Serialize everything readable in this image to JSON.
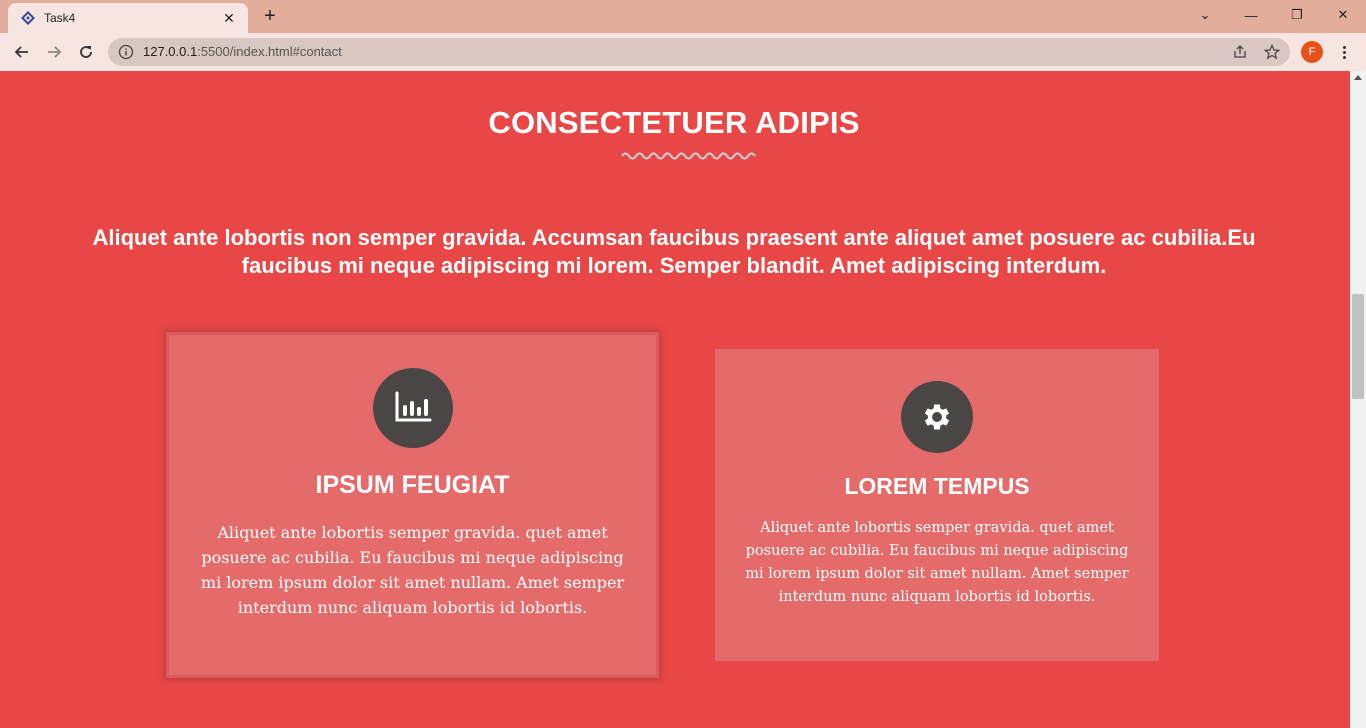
{
  "browser": {
    "tab_title": "Task4",
    "tab_close": "✕",
    "new_tab": "+",
    "url_host": "127.0.0.1",
    "url_path": ":5500/index.html#contact",
    "profile_initial": "F",
    "window_controls": {
      "tab_search": "⌄",
      "minimize": "—",
      "restore": "❐",
      "close": "✕"
    },
    "icons": [
      "back-arrow-icon",
      "forward-arrow-icon",
      "reload-icon",
      "info-icon",
      "share-icon",
      "star-icon",
      "kebab-menu-icon"
    ]
  },
  "page": {
    "section_title": "CONSECTETUER ADIPIS",
    "lead_text": "Aliquet ante lobortis non semper gravida. Accumsan faucibus praesent ante aliquet amet posuere ac cubilia.Eu faucibus mi neque adipiscing mi lorem. Semper blandit. Amet adipiscing interdum.",
    "cards": [
      {
        "icon": "bar-chart-icon",
        "title": "IPSUM FEUGIAT",
        "text": "Aliquet ante lobortis semper gravida. quet amet posuere ac cubilia. Eu faucibus mi neque adipiscing mi lorem ipsum dolor sit amet nullam. Amet semper interdum nunc aliquam lobortis id lobortis."
      },
      {
        "icon": "gear-icon",
        "title": "LOREM TEMPUS",
        "text": "Aliquet ante lobortis semper gravida. quet amet posuere ac cubilia. Eu faucibus mi neque adipiscing mi lorem ipsum dolor sit amet nullam. Amet semper interdum nunc aliquam lobortis id lobortis."
      }
    ]
  },
  "colors": {
    "page_background": "#e84746",
    "card_background": "#e56b6b",
    "icon_circle": "#4a4646",
    "tabstrip": "#e2ad9b",
    "toolbar": "#f6e5e1"
  }
}
